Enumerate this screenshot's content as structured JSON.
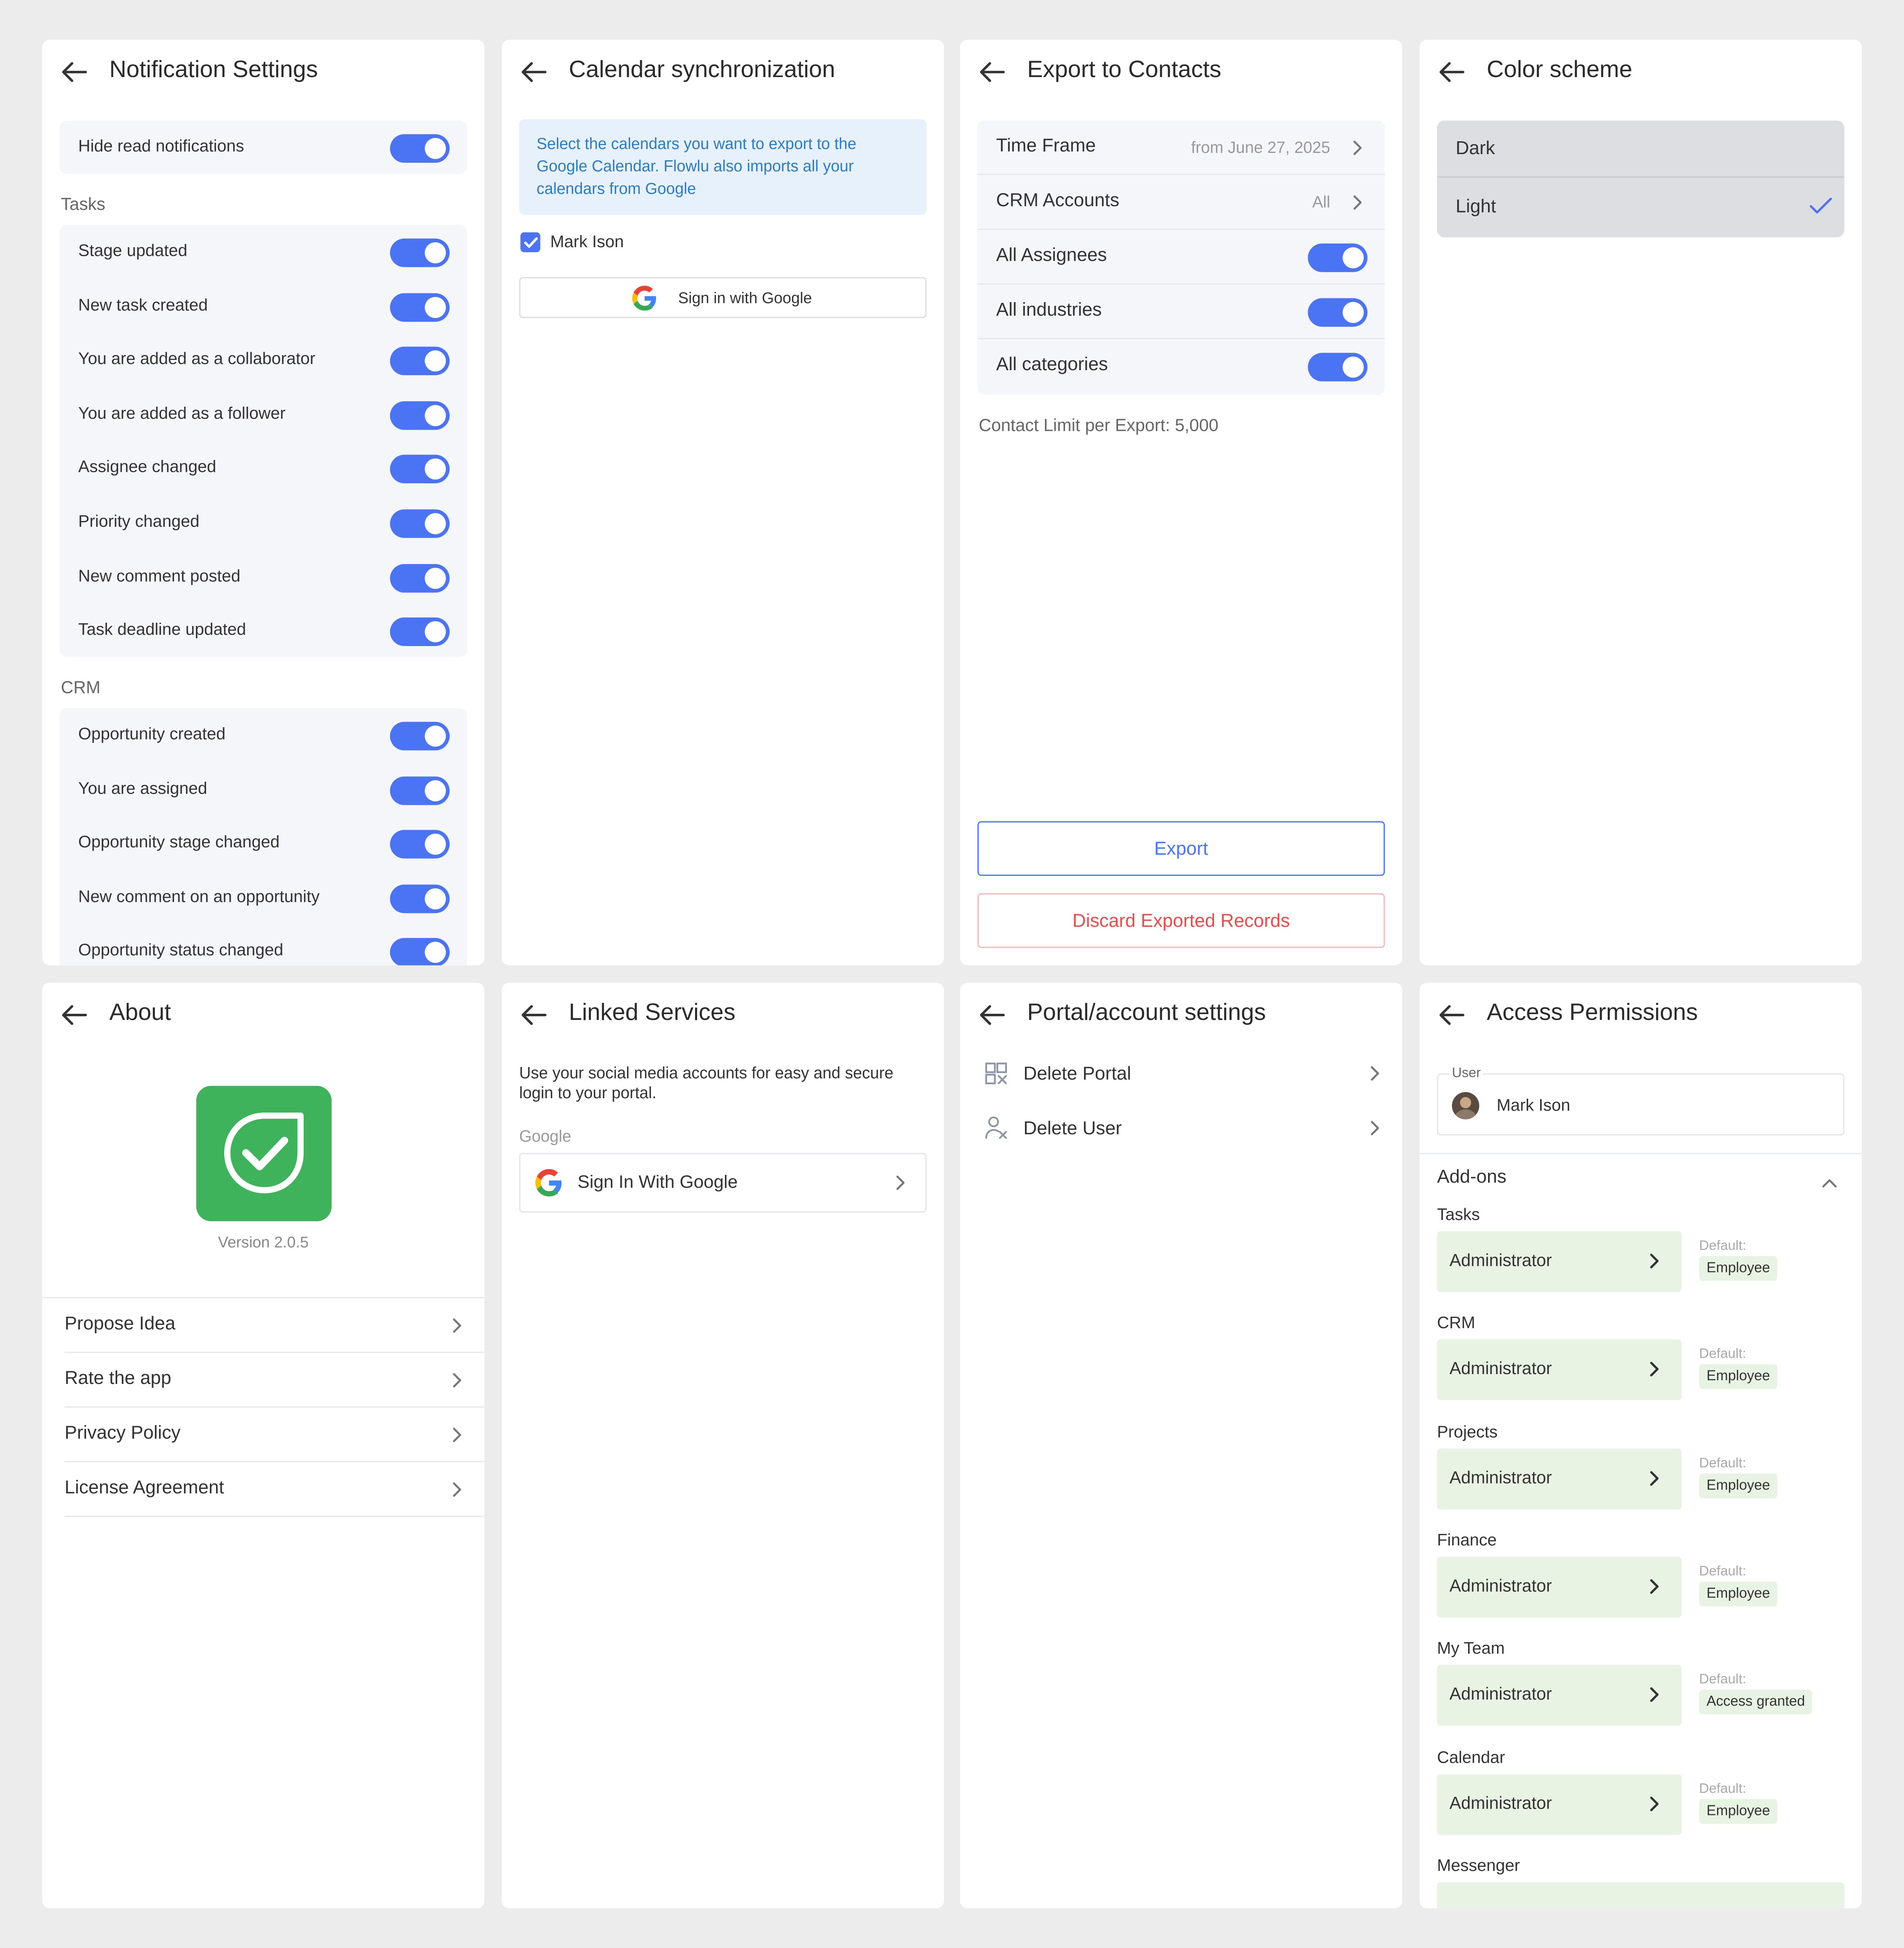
{
  "colors": {
    "accent": "#4b74f5",
    "danger": "#e84d4d",
    "info_text": "#2b7cc4",
    "app_green": "#3fb35b"
  },
  "notifications": {
    "title": "Notification Settings",
    "hide_read": "Hide read notifications",
    "tasks_section": "Tasks",
    "tasks": [
      "Stage updated",
      "New task created",
      "You are added as a collaborator",
      "You are added as a follower",
      "Assignee changed",
      "Priority changed",
      "New comment posted",
      "Task deadline updated"
    ],
    "crm_section": "CRM",
    "crm": [
      "Opportunity created",
      "You are assigned",
      "Opportunity stage changed",
      "New comment on an opportunity",
      "Opportunity status changed"
    ]
  },
  "calendar": {
    "title": "Calendar synchronization",
    "info": "Select the calendars you want to export to the Google Calendar. Flowlu also imports all your calendars from Google",
    "account": "Mark Ison",
    "sign_in": "Sign in with Google"
  },
  "export": {
    "title": "Export to Contacts",
    "time_frame_label": "Time Frame",
    "time_frame_value": "from June 27, 2025",
    "crm_accounts_label": "CRM Accounts",
    "crm_accounts_value": "All",
    "toggles": [
      "All Assignees",
      "All industries",
      "All categories"
    ],
    "limit": "Contact Limit per Export: 5,000",
    "export_btn": "Export",
    "discard_btn": "Discard Exported Records"
  },
  "color_scheme": {
    "title": "Color scheme",
    "options": [
      "Dark",
      "Light"
    ],
    "selected": "Light"
  },
  "about": {
    "title": "About",
    "version": "Version 2.0.5",
    "items": [
      "Propose Idea",
      "Rate the app",
      "Privacy Policy",
      "License Agreement"
    ]
  },
  "linked": {
    "title": "Linked Services",
    "desc": "Use your social media accounts for easy and secure login to your portal.",
    "section": "Google",
    "sign_in": "Sign In With Google"
  },
  "portal": {
    "title": "Portal/account settings",
    "items": [
      "Delete Portal",
      "Delete User"
    ]
  },
  "access": {
    "title": "Access Permissions",
    "user_label": "User",
    "user_name": "Mark Ison",
    "addons_label": "Add-ons",
    "default_label": "Default:",
    "modules": [
      {
        "name": "Tasks",
        "role": "Administrator",
        "default": "Employee"
      },
      {
        "name": "CRM",
        "role": "Administrator",
        "default": "Employee"
      },
      {
        "name": "Projects",
        "role": "Administrator",
        "default": "Employee"
      },
      {
        "name": "Finance",
        "role": "Administrator",
        "default": "Employee"
      },
      {
        "name": "My Team",
        "role": "Administrator",
        "default": "Access granted"
      },
      {
        "name": "Calendar",
        "role": "Administrator",
        "default": "Employee"
      },
      {
        "name": "Messenger",
        "role": "",
        "default": ""
      }
    ]
  }
}
